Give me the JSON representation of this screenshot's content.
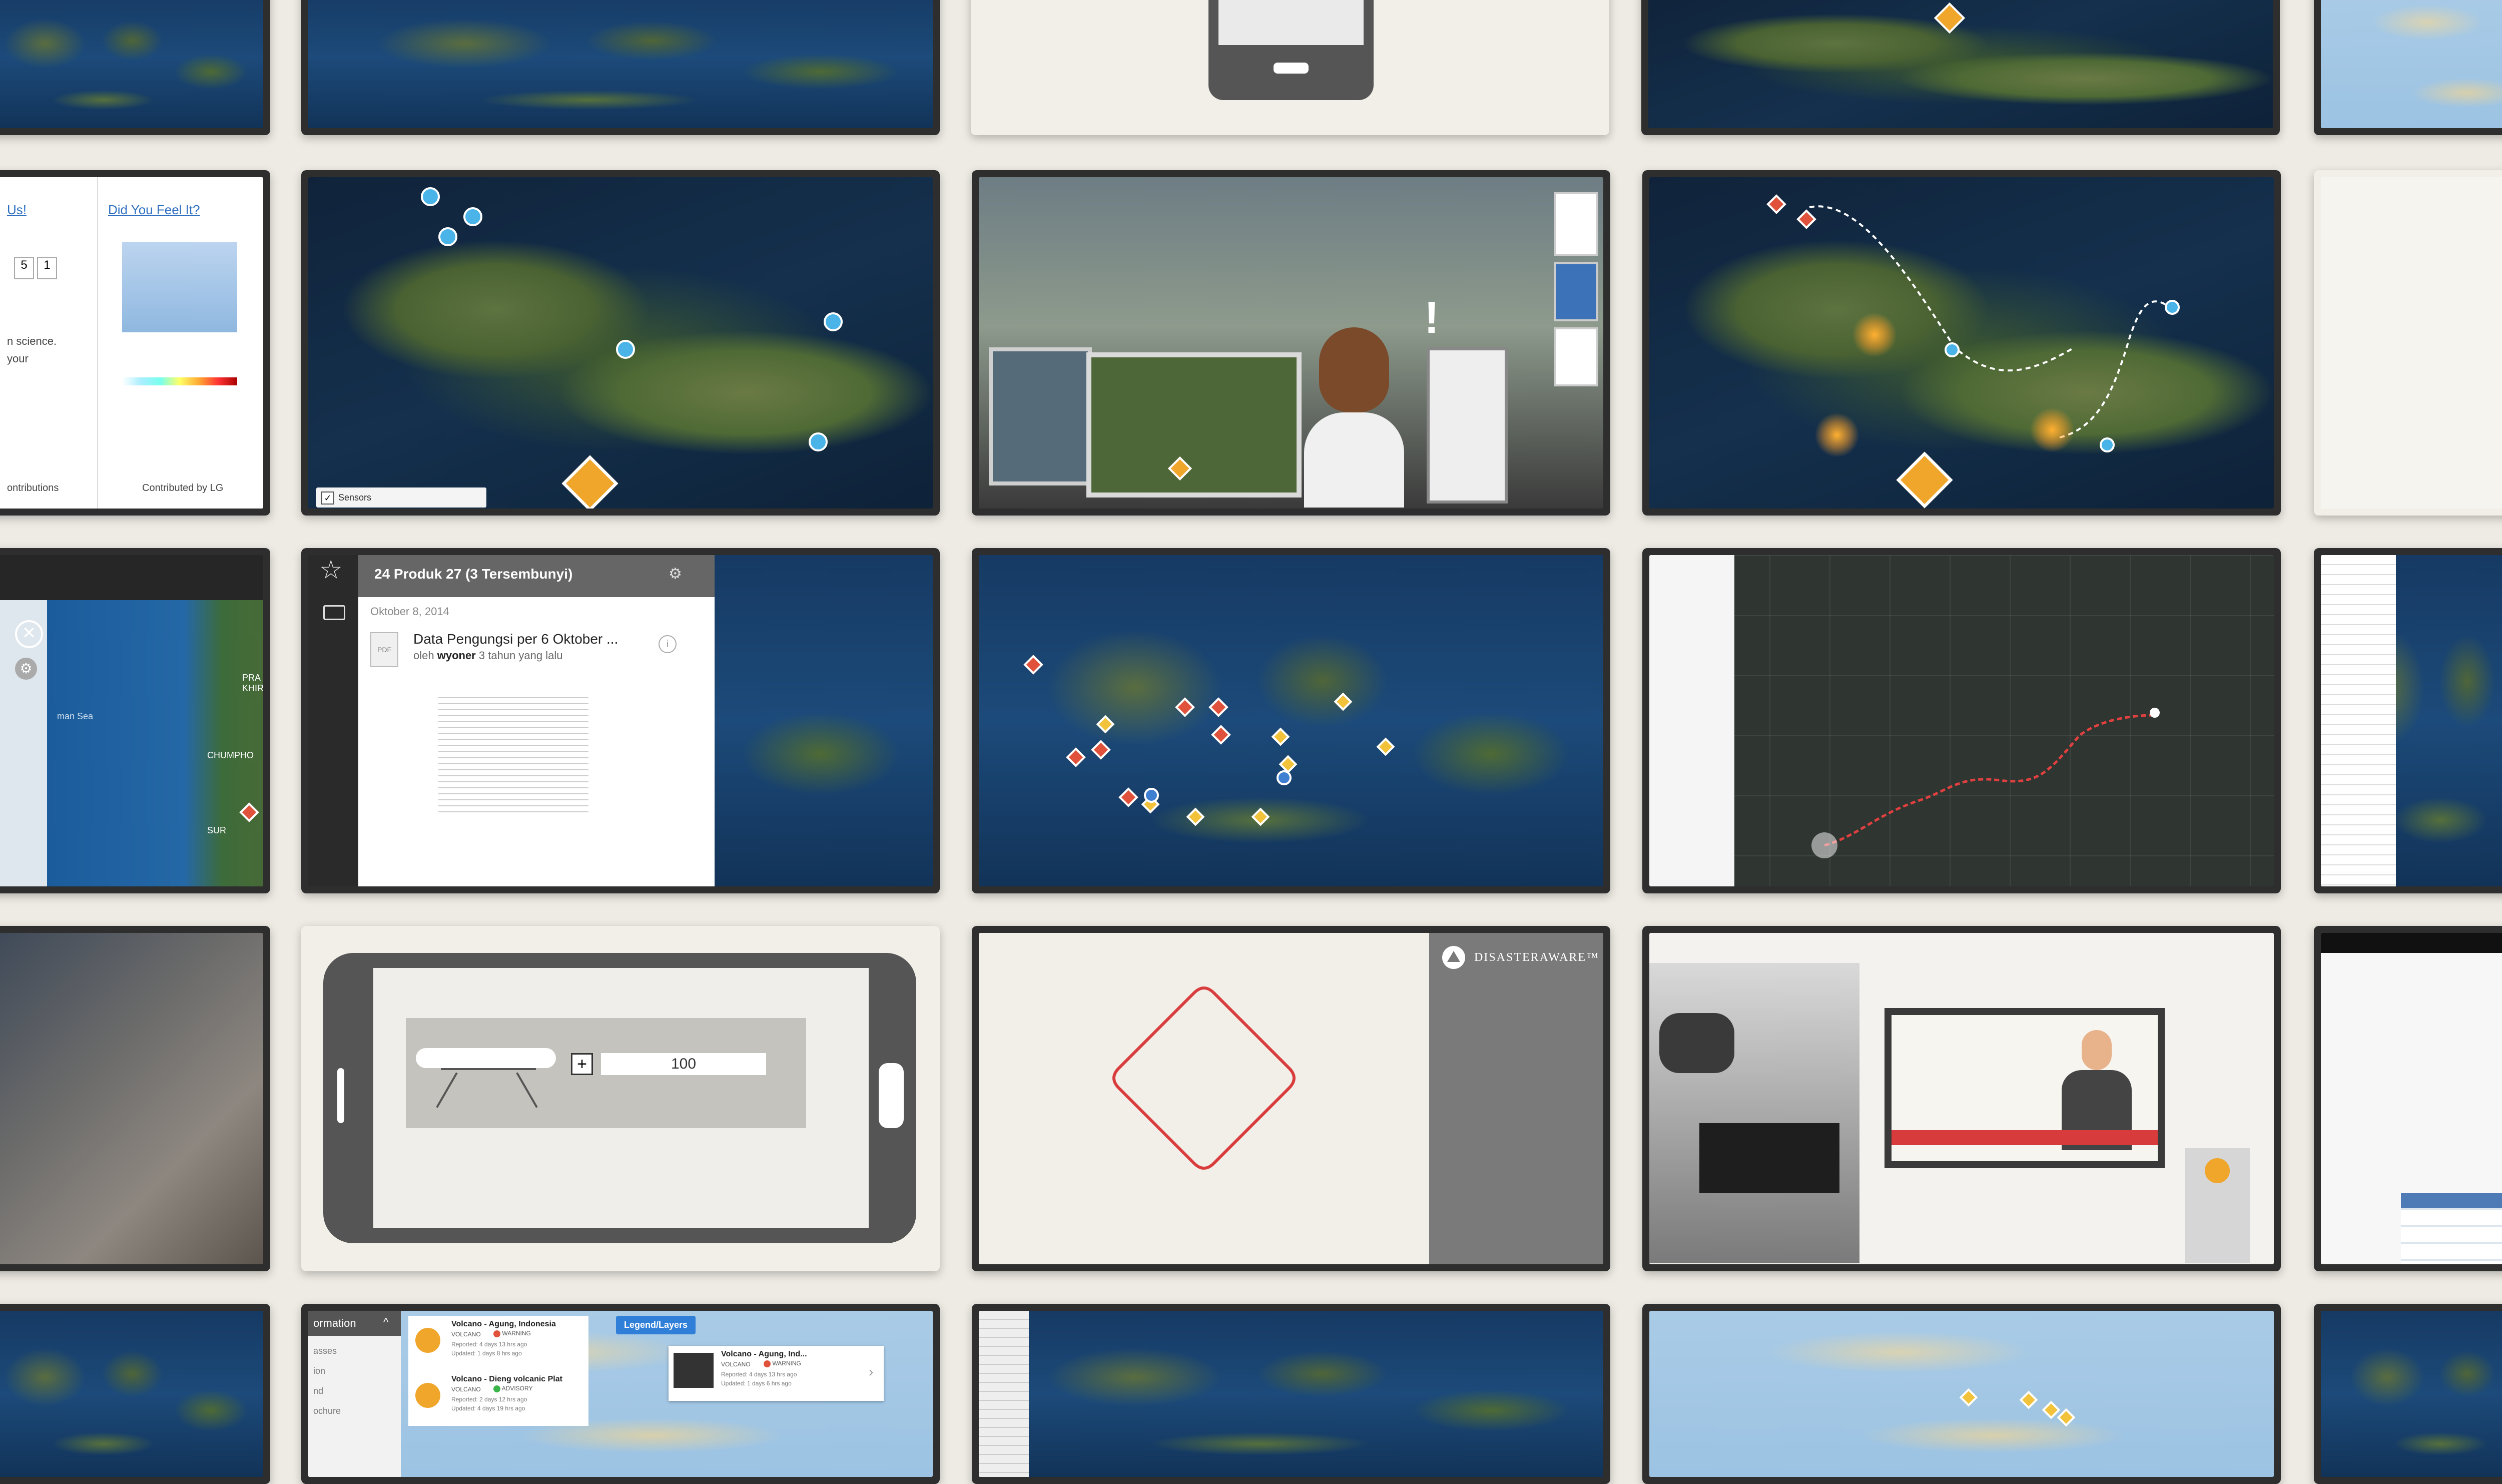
{
  "tiles": {
    "survey": {
      "link_left": "Us!",
      "link_title": "Did You Feel It?",
      "box1": "5",
      "box2": "1",
      "text_science": "n science.",
      "text_your": "your",
      "footer_left": "ontributions",
      "footer_right": "Contributed by LG"
    },
    "sensors": {
      "checkbox_label": "Sensors"
    },
    "coast_nav": {
      "place1": "PRA",
      "place2": "KHIR",
      "place3": "CHUMPHO",
      "place4": "SUR",
      "place5": "man Sea"
    },
    "document_panel": {
      "header": "24 Produk 27 (3 Tersembunyi)",
      "date": "Oktober 8, 2014",
      "item_title": "Data Pengungsi per 6 Oktober ...",
      "item_by": "oleh",
      "item_author": "wyoner",
      "item_age": "3 tahun yang lalu",
      "file_icon_label": "PDF"
    },
    "stretcher": {
      "quantity": "100"
    },
    "logo_tile": {
      "logo_text": "DISASTERAWARE™"
    },
    "volcano_panel": {
      "sidebar_title": "ormation",
      "sidebar_items": [
        "asses",
        "ion",
        "nd",
        "ochure"
      ],
      "legend_button": "Legend/Layers",
      "alert1_title": "Volcano - Agung, Indonesia",
      "alert1_type": "VOLCANO",
      "alert1_level": "WARNING",
      "alert1_reported": "Reported: 4 days 13 hrs ago",
      "alert1_updated": "Updated: 1 days 8 hrs ago",
      "alert2_title": "Volcano - Dieng volcanic Plat",
      "alert2_type": "VOLCANO",
      "alert2_level": "ADVISORY",
      "alert2_reported": "Reported: 2 days 12 hrs ago",
      "alert2_updated": "Updated: 4 days 19 hrs ago",
      "popup_title": "Volcano - Agung, Ind...",
      "popup_type": "VOLCANO",
      "popup_level": "WARNING",
      "popup_reported": "Reported: 4 days 13 hrs ago",
      "popup_updated": "Updated: 1 days 6 hrs ago"
    }
  },
  "colors": {
    "page_bg": "#eeebe4",
    "tile_frame": "#2e2e2e",
    "warning_red": "#e0523b",
    "advisory_green": "#3bb54a",
    "accent_blue": "#2f7ed8",
    "marker_orange": "#f0a52b"
  }
}
